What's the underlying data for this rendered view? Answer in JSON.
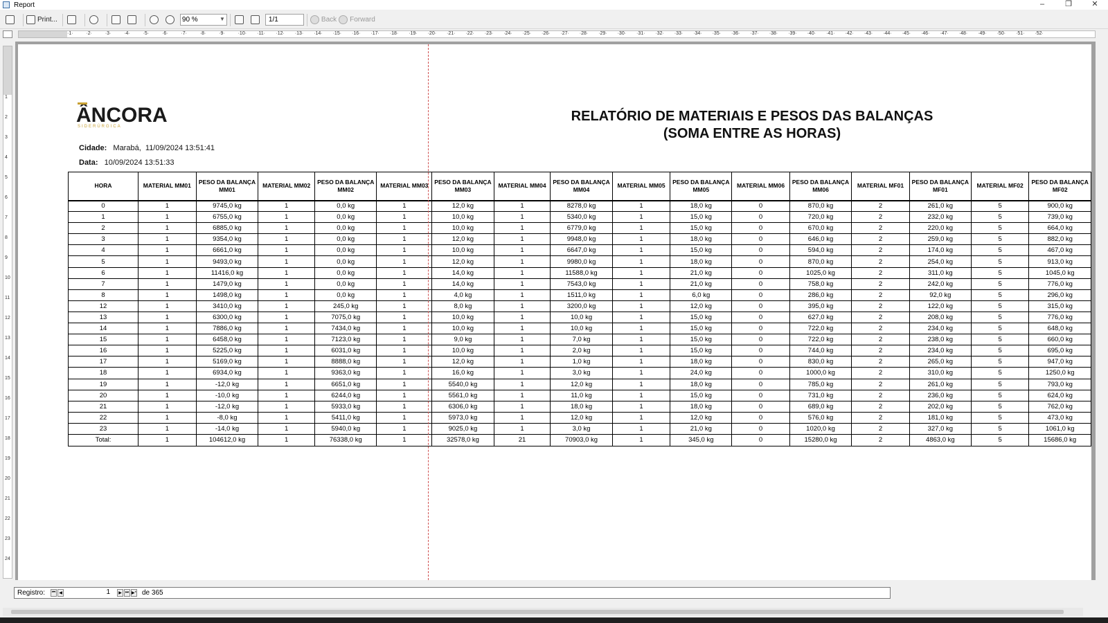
{
  "window": {
    "title": "Report",
    "minimize": "–",
    "maximize": "❐",
    "close": "✕"
  },
  "toolbar": {
    "print_label": "Print...",
    "zoom_value": "90 %",
    "page_value": "1/1",
    "back_label": "Back",
    "forward_label": "Forward"
  },
  "report": {
    "logo_text": "ÂNCORA",
    "logo_sub": "SIDERÚRGICA",
    "title_line1": "RELATÓRIO DE MATERIAIS E PESOS DAS BALANÇAS",
    "title_line2": "(SOMA ENTRE AS HORAS)",
    "cidade_label": "Cidade:",
    "cidade_value": "Marabá,",
    "cidade_datetime": "11/09/2024 13:51:41",
    "data_label": "Data:",
    "data_value": "10/09/2024 13:51:33"
  },
  "table": {
    "columns": [
      "HORA",
      "MATERIAL MM01",
      "PESO DA BALANÇA MM01",
      "MATERIAL MM02",
      "PESO DA BALANÇA MM02",
      "MATERIAL MM03",
      "PESO DA BALANÇA MM03",
      "MATERIAL MM04",
      "PESO DA BALANÇA MM04",
      "MATERIAL MM05",
      "PESO DA BALANÇA MM05",
      "MATERIAL MM06",
      "PESO DA BALANÇA MM06",
      "MATERIAL MF01",
      "PESO DA BALANÇA MF01",
      "MATERIAL MF02",
      "PESO DA BALANÇA MF02"
    ],
    "rows": [
      [
        "0",
        "1",
        "9745,0 kg",
        "1",
        "0,0 kg",
        "1",
        "12,0 kg",
        "1",
        "8278,0 kg",
        "1",
        "18,0 kg",
        "0",
        "870,0 kg",
        "2",
        "261,0 kg",
        "5",
        "900,0 kg"
      ],
      [
        "1",
        "1",
        "6755,0 kg",
        "1",
        "0,0 kg",
        "1",
        "10,0 kg",
        "1",
        "5340,0 kg",
        "1",
        "15,0 kg",
        "0",
        "720,0 kg",
        "2",
        "232,0 kg",
        "5",
        "739,0 kg"
      ],
      [
        "2",
        "1",
        "6885,0 kg",
        "1",
        "0,0 kg",
        "1",
        "10,0 kg",
        "1",
        "6779,0 kg",
        "1",
        "15,0 kg",
        "0",
        "670,0 kg",
        "2",
        "220,0 kg",
        "5",
        "664,0 kg"
      ],
      [
        "3",
        "1",
        "9354,0 kg",
        "1",
        "0,0 kg",
        "1",
        "12,0 kg",
        "1",
        "9948,0 kg",
        "1",
        "18,0 kg",
        "0",
        "646,0 kg",
        "2",
        "259,0 kg",
        "5",
        "882,0 kg"
      ],
      [
        "4",
        "1",
        "6661,0 kg",
        "1",
        "0,0 kg",
        "1",
        "10,0 kg",
        "1",
        "6647,0 kg",
        "1",
        "15,0 kg",
        "0",
        "594,0 kg",
        "2",
        "174,0 kg",
        "5",
        "467,0 kg"
      ],
      [
        "5",
        "1",
        "9493,0 kg",
        "1",
        "0,0 kg",
        "1",
        "12,0 kg",
        "1",
        "9980,0 kg",
        "1",
        "18,0 kg",
        "0",
        "870,0 kg",
        "2",
        "254,0 kg",
        "5",
        "913,0 kg"
      ],
      [
        "6",
        "1",
        "11416,0 kg",
        "1",
        "0,0 kg",
        "1",
        "14,0 kg",
        "1",
        "11588,0 kg",
        "1",
        "21,0 kg",
        "0",
        "1025,0 kg",
        "2",
        "311,0 kg",
        "5",
        "1045,0 kg"
      ],
      [
        "7",
        "1",
        "1479,0 kg",
        "1",
        "0,0 kg",
        "1",
        "14,0 kg",
        "1",
        "7543,0 kg",
        "1",
        "21,0 kg",
        "0",
        "758,0 kg",
        "2",
        "242,0 kg",
        "5",
        "776,0 kg"
      ],
      [
        "8",
        "1",
        "1498,0 kg",
        "1",
        "0,0 kg",
        "1",
        "4,0 kg",
        "1",
        "1511,0 kg",
        "1",
        "6,0 kg",
        "0",
        "286,0 kg",
        "2",
        "92,0 kg",
        "5",
        "296,0 kg"
      ],
      [
        "12",
        "1",
        "3410,0 kg",
        "1",
        "245,0 kg",
        "1",
        "8,0 kg",
        "1",
        "3200,0 kg",
        "1",
        "12,0 kg",
        "0",
        "395,0 kg",
        "2",
        "122,0 kg",
        "5",
        "315,0 kg"
      ],
      [
        "13",
        "1",
        "6300,0 kg",
        "1",
        "7075,0 kg",
        "1",
        "10,0 kg",
        "1",
        "10,0 kg",
        "1",
        "15,0 kg",
        "0",
        "627,0 kg",
        "2",
        "208,0 kg",
        "5",
        "776,0 kg"
      ],
      [
        "14",
        "1",
        "7886,0 kg",
        "1",
        "7434,0 kg",
        "1",
        "10,0 kg",
        "1",
        "10,0 kg",
        "1",
        "15,0 kg",
        "0",
        "722,0 kg",
        "2",
        "234,0 kg",
        "5",
        "648,0 kg"
      ],
      [
        "15",
        "1",
        "6458,0 kg",
        "1",
        "7123,0 kg",
        "1",
        "9,0 kg",
        "1",
        "7,0 kg",
        "1",
        "15,0 kg",
        "0",
        "722,0 kg",
        "2",
        "238,0 kg",
        "5",
        "660,0 kg"
      ],
      [
        "16",
        "1",
        "5225,0 kg",
        "1",
        "6031,0 kg",
        "1",
        "10,0 kg",
        "1",
        "2,0 kg",
        "1",
        "15,0 kg",
        "0",
        "744,0 kg",
        "2",
        "234,0 kg",
        "5",
        "695,0 kg"
      ],
      [
        "17",
        "1",
        "5169,0 kg",
        "1",
        "8888,0 kg",
        "1",
        "12,0 kg",
        "1",
        "1,0 kg",
        "1",
        "18,0 kg",
        "0",
        "830,0 kg",
        "2",
        "265,0 kg",
        "5",
        "947,0 kg"
      ],
      [
        "18",
        "1",
        "6934,0 kg",
        "1",
        "9363,0 kg",
        "1",
        "16,0 kg",
        "1",
        "3,0 kg",
        "1",
        "24,0 kg",
        "0",
        "1000,0 kg",
        "2",
        "310,0 kg",
        "5",
        "1250,0 kg"
      ],
      [
        "19",
        "1",
        "-12,0 kg",
        "1",
        "6651,0 kg",
        "1",
        "5540,0 kg",
        "1",
        "12,0 kg",
        "1",
        "18,0 kg",
        "0",
        "785,0 kg",
        "2",
        "261,0 kg",
        "5",
        "793,0 kg"
      ],
      [
        "20",
        "1",
        "-10,0 kg",
        "1",
        "6244,0 kg",
        "1",
        "5561,0 kg",
        "1",
        "11,0 kg",
        "1",
        "15,0 kg",
        "0",
        "731,0 kg",
        "2",
        "236,0 kg",
        "5",
        "624,0 kg"
      ],
      [
        "21",
        "1",
        "-12,0 kg",
        "1",
        "5933,0 kg",
        "1",
        "6306,0 kg",
        "1",
        "18,0 kg",
        "1",
        "18,0 kg",
        "0",
        "689,0 kg",
        "2",
        "202,0 kg",
        "5",
        "762,0 kg"
      ],
      [
        "22",
        "1",
        "-8,0 kg",
        "1",
        "5411,0 kg",
        "1",
        "5973,0 kg",
        "1",
        "12,0 kg",
        "1",
        "12,0 kg",
        "0",
        "576,0 kg",
        "2",
        "181,0 kg",
        "5",
        "473,0 kg"
      ],
      [
        "23",
        "1",
        "-14,0 kg",
        "1",
        "5940,0 kg",
        "1",
        "9025,0 kg",
        "1",
        "3,0 kg",
        "1",
        "21,0 kg",
        "0",
        "1020,0 kg",
        "2",
        "327,0 kg",
        "5",
        "1061,0 kg"
      ]
    ],
    "total": [
      "Total:",
      "1",
      "104612,0 kg",
      "1",
      "76338,0 kg",
      "1",
      "32578,0 kg",
      "21",
      "70903,0 kg",
      "1",
      "345,0 kg",
      "0",
      "15280,0 kg",
      "2",
      "4863,0 kg",
      "5",
      "15686,0 kg"
    ]
  },
  "navigator": {
    "label": "Registro:",
    "current": "1",
    "of_text": "de 365"
  }
}
